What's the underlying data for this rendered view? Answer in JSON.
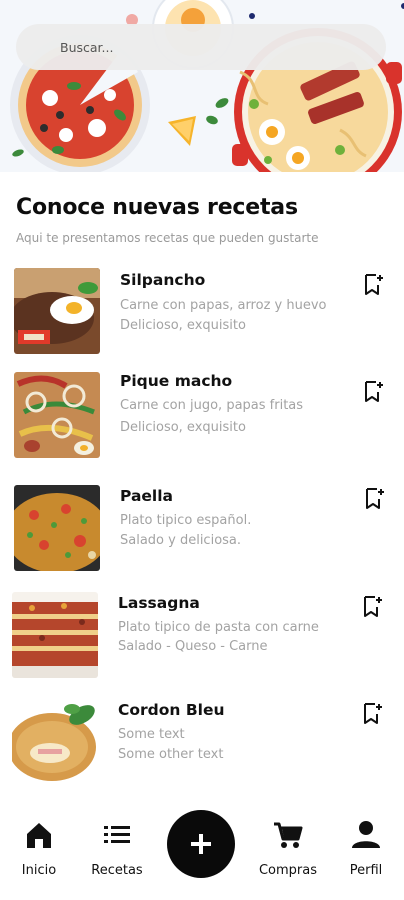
{
  "search": {
    "placeholder": "Buscar..."
  },
  "section": {
    "title": "Conoce nuevas recetas",
    "subtitle": "Aqui te presentamos recetas que pueden gustarte"
  },
  "recipes": [
    {
      "name": "Silpancho",
      "line1": "Carne con papas, arroz y huevo",
      "line2": "Delicioso, exquisito"
    },
    {
      "name": "Pique macho",
      "line1": "Carne con jugo, papas fritas",
      "line2": "Delicioso, exquisito"
    },
    {
      "name": "Paella",
      "line1": "Plato tipico español.",
      "line2": "Salado y deliciosa."
    },
    {
      "name": "Lassagna",
      "line1": "Plato tipico de pasta con carne",
      "line2": "Salado - Queso - Carne"
    },
    {
      "name": "Cordon Bleu",
      "line1": "Some text",
      "line2": "Some other text"
    }
  ],
  "nav": {
    "home": "Inicio",
    "recipes": "Recetas",
    "cart": "Compras",
    "profile": "Perfil"
  },
  "icons": {
    "search": "search-icon",
    "bookmark": "bookmark-add-icon",
    "home": "home-icon",
    "list": "list-icon",
    "add": "plus-icon",
    "cart": "cart-icon",
    "profile": "person-icon"
  },
  "colors": {
    "accent": "#0a0a0a",
    "muted_text": "#a3a3a3",
    "search_bg": "#ececec"
  }
}
